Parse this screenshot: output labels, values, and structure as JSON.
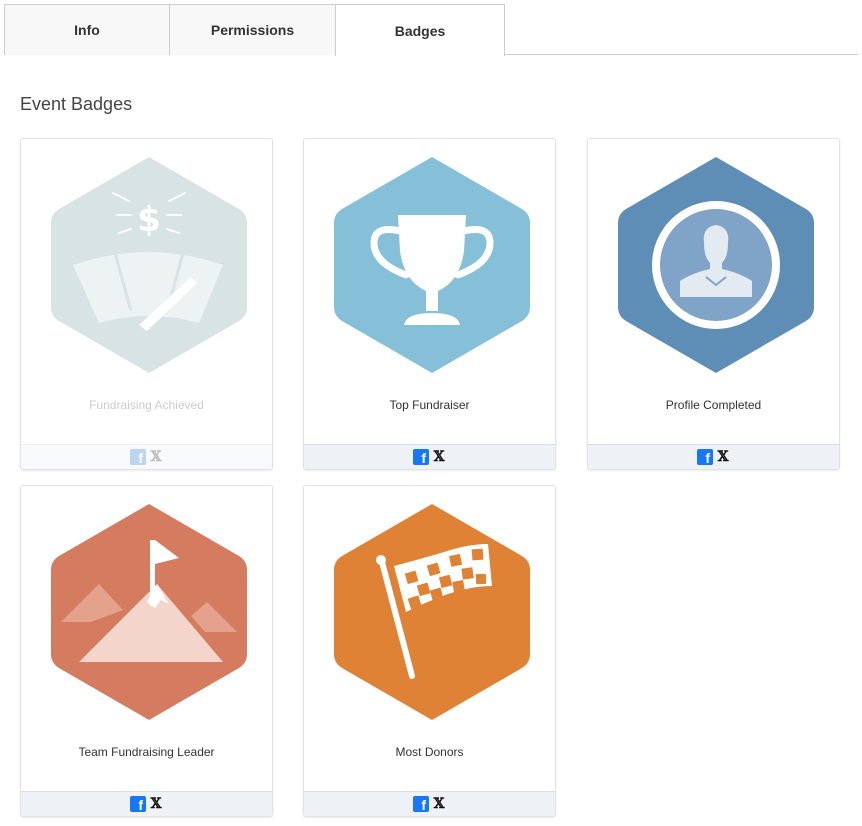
{
  "tabs": [
    {
      "label": "Info"
    },
    {
      "label": "Permissions"
    },
    {
      "label": "Badges"
    }
  ],
  "section": {
    "title": "Event Badges"
  },
  "badges": [
    {
      "name": "Fundraising Achieved",
      "state": "locked",
      "icon": "speedometer-dollar-icon",
      "color": "#d8e3e3"
    },
    {
      "name": "Top Fundraiser",
      "state": "earned",
      "icon": "trophy-icon",
      "color": "#85bfd8"
    },
    {
      "name": "Profile Completed",
      "state": "earned",
      "icon": "profile-icon",
      "color": "#5e8db5"
    },
    {
      "name": "Team Fundraising Leader",
      "state": "earned",
      "icon": "mountain-flag-icon",
      "color": "#d47b60"
    },
    {
      "name": "Most Donors",
      "state": "earned",
      "icon": "checkered-flag-icon",
      "color": "#df8236"
    }
  ],
  "share": {
    "facebook_glyph": "f",
    "x_glyph": "𝕏"
  }
}
